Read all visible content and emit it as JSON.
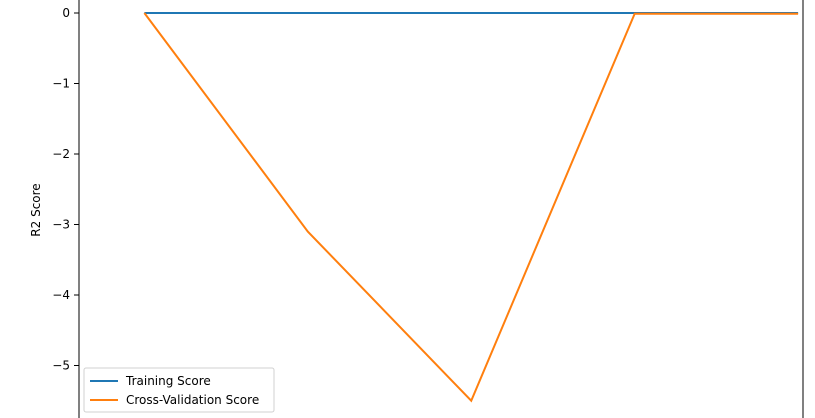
{
  "chart_data": {
    "type": "line",
    "title": "",
    "xlabel": "",
    "ylabel": "R2 Score",
    "ylim": [
      -5.6,
      0.03
    ],
    "yticks": [
      "0",
      "−1",
      "−2",
      "−3",
      "−4",
      "−5"
    ],
    "ytick_values": [
      0,
      -1,
      -2,
      -3,
      -4,
      -5
    ],
    "x": [
      1,
      2,
      3,
      4,
      5
    ],
    "xlim": [
      0.6,
      5.03
    ],
    "series": [
      {
        "name": "Training Score",
        "color": "#1f77b4",
        "values": [
          0.0,
          0.0,
          0.0,
          0.0,
          0.0
        ]
      },
      {
        "name": "Cross-Validation Score",
        "color": "#ff7f0e",
        "values": [
          0.0,
          -3.1,
          -5.5,
          -0.01,
          -0.01
        ]
      }
    ],
    "legend": "lower-left",
    "grid": false
  }
}
